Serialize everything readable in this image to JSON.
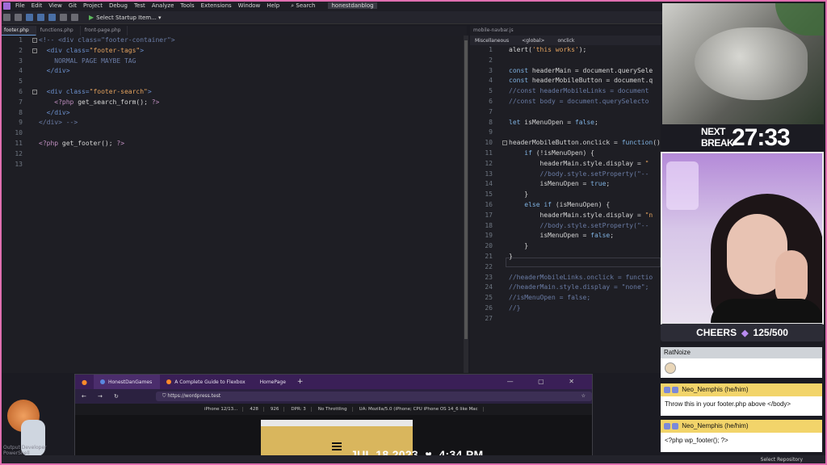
{
  "menubar": {
    "items": [
      "File",
      "Edit",
      "View",
      "Git",
      "Project",
      "Debug",
      "Test",
      "Analyze",
      "Tools",
      "Extensions",
      "Window",
      "Help"
    ],
    "search": "Search",
    "project_name": "honestdanblog"
  },
  "toolbar": {
    "startup_label": "Select Startup Item..."
  },
  "left_editor": {
    "tabs": [
      "footer.php",
      "functions.php",
      "front-page.php"
    ],
    "lines": [
      {
        "n": "1",
        "html": "<span class='c-cmt'>&lt;!-- &lt;div class=\"footer-container\"&gt;</span>"
      },
      {
        "n": "2",
        "html": "  <span class='c-tag'>&lt;div class=</span><span class='c-str'>\"footer-tags\"</span><span class='c-tag'>&gt;</span>"
      },
      {
        "n": "3",
        "html": "    <span class='c-txt'>NORMAL PAGE MAYBE TAG</span>"
      },
      {
        "n": "4",
        "html": "  <span class='c-tag'>&lt;/div&gt;</span>"
      },
      {
        "n": "5",
        "html": ""
      },
      {
        "n": "6",
        "html": "  <span class='c-tag'>&lt;div class=</span><span class='c-str'>\"footer-search\"</span><span class='c-tag'>&gt;</span>"
      },
      {
        "n": "7",
        "html": "    <span class='c-php'>&lt;?php</span> <span class='c-fn'>get_search_form();</span> <span class='c-php'>?&gt;</span>"
      },
      {
        "n": "8",
        "html": "  <span class='c-tag'>&lt;/div&gt;</span>"
      },
      {
        "n": "9",
        "html": "<span class='c-cmt'>&lt;/div&gt; --&gt;</span>"
      },
      {
        "n": "10",
        "html": ""
      },
      {
        "n": "11",
        "html": "<span class='c-php'>&lt;?php</span> <span class='c-fn'>get_footer();</span> <span class='c-php'>?&gt;</span>"
      },
      {
        "n": "12",
        "html": ""
      },
      {
        "n": "13",
        "html": ""
      }
    ]
  },
  "right_editor": {
    "tab": "mobile-navbar.js",
    "nav": [
      "Miscellaneous",
      "<global>",
      "onclick"
    ],
    "lines": [
      {
        "n": "1",
        "html": "<span class='c-fn'>alert(</span><span class='c-str'>'this works'</span><span class='c-fn'>);</span>"
      },
      {
        "n": "2",
        "html": ""
      },
      {
        "n": "3",
        "html": "<span class='c-kw'>const</span> <span class='c-fn'>headerMain = document.querySele</span>"
      },
      {
        "n": "4",
        "html": "<span class='c-kw'>const</span> <span class='c-fn'>headerMobileButton = document.q</span>"
      },
      {
        "n": "5",
        "html": "<span class='c-cmt'>//const headerMobileLinks = document</span>"
      },
      {
        "n": "6",
        "html": "<span class='c-cmt'>//const body = document.querySelecto</span>"
      },
      {
        "n": "7",
        "html": ""
      },
      {
        "n": "8",
        "html": "<span class='c-kw'>let</span> <span class='c-fn'>isMenuOpen = </span><span class='c-kw'>false</span><span class='c-fn'>;</span>"
      },
      {
        "n": "9",
        "html": ""
      },
      {
        "n": "10",
        "html": "<span class='c-fn'>headerMobileButton.onclick = </span><span class='c-kw'>function</span><span class='c-fn'>() {</span>"
      },
      {
        "n": "11",
        "html": "    <span class='c-kw'>if</span> <span class='c-fn'>(!isMenuOpen) {</span>"
      },
      {
        "n": "12",
        "html": "        <span class='c-fn'>headerMain.style.display = </span><span class='c-str'>\"</span>"
      },
      {
        "n": "13",
        "html": "        <span class='c-cmt'>//body.style.setProperty(\"--</span>"
      },
      {
        "n": "14",
        "html": "        <span class='c-fn'>isMenuOpen = </span><span class='c-kw'>true</span><span class='c-fn'>;</span>"
      },
      {
        "n": "15",
        "html": "    <span class='c-fn'>}</span>"
      },
      {
        "n": "16",
        "html": "    <span class='c-kw'>else if</span> <span class='c-fn'>(isMenuOpen) {</span>"
      },
      {
        "n": "17",
        "html": "        <span class='c-fn'>headerMain.style.display = </span><span class='c-str'>\"n</span>"
      },
      {
        "n": "18",
        "html": "        <span class='c-cmt'>//body.style.setProperty(\"--</span>"
      },
      {
        "n": "19",
        "html": "        <span class='c-fn'>isMenuOpen = </span><span class='c-kw'>false</span><span class='c-fn'>;</span>"
      },
      {
        "n": "20",
        "html": "    <span class='c-fn'>}</span>"
      },
      {
        "n": "21",
        "html": "<span class='c-fn'>}</span>"
      },
      {
        "n": "22",
        "html": ""
      },
      {
        "n": "23",
        "html": "<span class='c-cmt'>//headerMobileLinks.onclick = functio</span>"
      },
      {
        "n": "24",
        "html": "<span class='c-cmt'>//headerMain.style.display = \"none\";</span>"
      },
      {
        "n": "25",
        "html": "<span class='c-cmt'>//isMenuOpen = false;</span>"
      },
      {
        "n": "26",
        "html": "<span class='c-cmt'>//}</span>"
      },
      {
        "n": "27",
        "html": ""
      }
    ]
  },
  "overlay": {
    "break_label": "NEXT BREAK",
    "break_time": "27:33",
    "cheers_label": "CHEERS",
    "cheers_count": "125/500",
    "date": "JUL 18 2023",
    "time": "4:34 PM"
  },
  "chat": {
    "messages": [
      {
        "user": "RatNoize",
        "text": ""
      },
      {
        "user": "Neo_Nemphis (he/him)",
        "text": "Throw this in your footer.php above </body>"
      },
      {
        "user": "Neo_Nemphis (he/him)",
        "text": "<?php wp_footer(); ?>"
      }
    ]
  },
  "browser": {
    "tabs": [
      "HonestDanGames",
      "A Complete Guide to Flexbox",
      "HomePage"
    ],
    "url": "https://wordpress.test",
    "dev": {
      "device": "iPhone 12/13...",
      "width": "428",
      "height": "926",
      "dpr": "DPR: 3",
      "throttle": "No Throttling",
      "ua": "UA: Mozilla/5.0 (iPhone; CPU iPhone OS 14_6 like Mac"
    }
  },
  "status": {
    "repo": "Select Repository"
  },
  "left_bottom": "Output  Developer PowerShell"
}
